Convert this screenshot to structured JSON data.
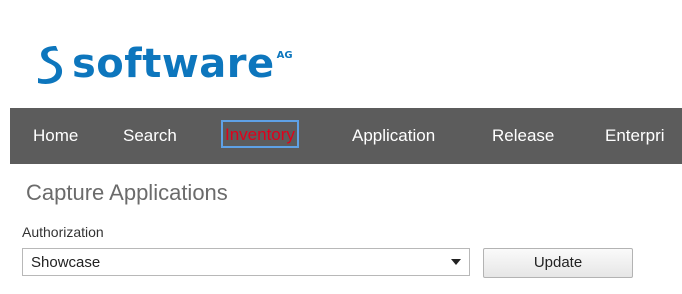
{
  "logo": {
    "wordmark": "software",
    "suffix": "AG",
    "brand_color": "#0d76bd",
    "icon": "software-ag-logo-mark"
  },
  "nav": {
    "background": "#5c5c5c",
    "active_color": "#e0001b",
    "items": [
      {
        "label": "Home"
      },
      {
        "label": "Search"
      },
      {
        "label": "Inventory",
        "active": true
      },
      {
        "label": "Application"
      },
      {
        "label": "Release"
      },
      {
        "label": "Enterpri"
      }
    ]
  },
  "main": {
    "title": "Capture Applications",
    "authorization": {
      "label": "Authorization",
      "selected": "Showcase"
    },
    "update_label": "Update"
  }
}
